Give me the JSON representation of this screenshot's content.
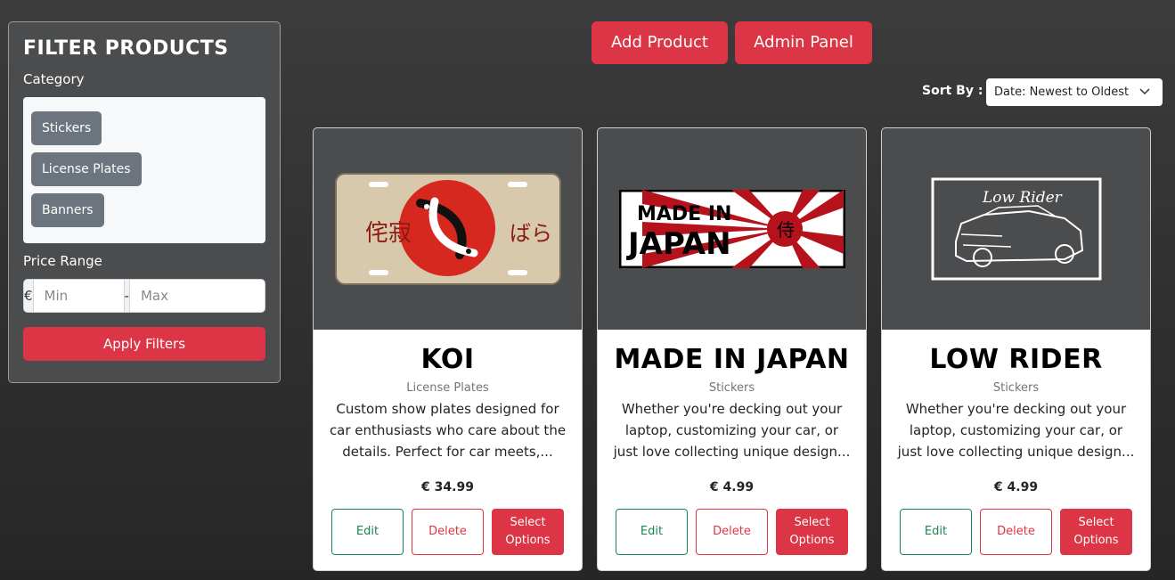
{
  "filter": {
    "heading": "FILTER PRODUCTS",
    "category_label": "Category",
    "categories": [
      "Stickers",
      "License Plates",
      "Banners"
    ],
    "price_label": "Price Range",
    "currency": "€",
    "min_placeholder": "Min",
    "dash": "-",
    "max_placeholder": "Max",
    "apply_label": "Apply Filters"
  },
  "header": {
    "add_product": "Add Product",
    "admin_panel": "Admin Panel",
    "sort_label": "Sort By :",
    "sort_value": "Date: Newest to Oldest"
  },
  "products": [
    {
      "title": "KOI",
      "category": "License Plates",
      "description": "Custom show plates designed for car enthusiasts who care about the details. Perfect for car meets,...",
      "price": "€ 34.99",
      "image_text": {
        "kanji_left": "侘寂",
        "kana_right": "ばら"
      },
      "edit": "Edit",
      "delete": "Delete",
      "select": "Select Options"
    },
    {
      "title": "MADE IN JAPAN",
      "category": "Stickers",
      "description": "Whether you're decking out your laptop, customizing your car, or just love collecting unique design...",
      "price": "€ 4.99",
      "image_text": {
        "line1": "MADE IN",
        "line2": "JAPAN",
        "kanji": "侍"
      },
      "edit": "Edit",
      "delete": "Delete",
      "select": "Select Options"
    },
    {
      "title": "LOW RIDER",
      "category": "Stickers",
      "description": "Whether you're decking out your laptop, customizing your car, or just love collecting unique design...",
      "price": "€ 4.99",
      "image_text": {
        "script": "Low Rider"
      },
      "edit": "Edit",
      "delete": "Delete",
      "select": "Select Options"
    }
  ]
}
